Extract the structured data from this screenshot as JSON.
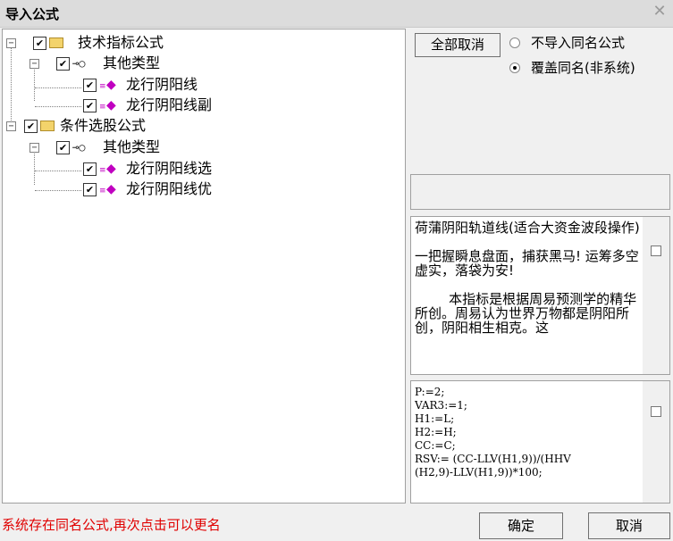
{
  "window": {
    "title": "导入公式",
    "close_icon": "close-icon"
  },
  "tree": {
    "nodes": [
      {
        "label": "技术指标公式",
        "level": 0,
        "icon": "folder-icon",
        "checked": true,
        "expander": "−"
      },
      {
        "label": "其他类型",
        "level": 1,
        "icon": "key-icon",
        "checked": true,
        "expander": "−"
      },
      {
        "label": "龙行阴阳线",
        "level": 2,
        "icon": "gem-icon",
        "checked": true
      },
      {
        "label": "龙行阴阳线副",
        "level": 2,
        "icon": "gem-icon",
        "checked": true
      },
      {
        "label": "条件选股公式",
        "level": 0,
        "icon": "folder-icon",
        "checked": true,
        "expander": "−"
      },
      {
        "label": "其他类型",
        "level": 1,
        "icon": "key-icon",
        "checked": true,
        "expander": "−"
      },
      {
        "label": "龙行阴阳线选",
        "level": 2,
        "icon": "gem-icon",
        "checked": true
      },
      {
        "label": "龙行阴阳线优",
        "level": 2,
        "icon": "gem-icon",
        "checked": true
      }
    ]
  },
  "buttons": {
    "cancel_all": "全部取消",
    "ok": "确定",
    "cancel": "取消"
  },
  "options": {
    "no_import": "不导入同名公式",
    "overwrite": "覆盖同名(非系统)",
    "selected": "overwrite"
  },
  "description": "荷蒲阴阳轨道线(适合大资金波段操作)\n\n一把握瞬息盘面，捕获黑马! 运筹多空虚实，落袋为安!\n\n        本指标是根据周易预测学的精华所创。周易认为世界万物都是阴阳所创，阴阳相生相克。这",
  "code": "P:=2;\nVAR3:=1;\nH1:=L;\nH2:=H;\nCC:=C;\nRSV:= (CC-LLV(H1,9))/(HHV\n(H2,9)-LLV(H1,9))*100;",
  "status": "系统存在同名公式,再次点击可以更名",
  "colors": {
    "status_text": "#e00000",
    "gem": "#c000c0",
    "folder": "#f3d36b"
  }
}
